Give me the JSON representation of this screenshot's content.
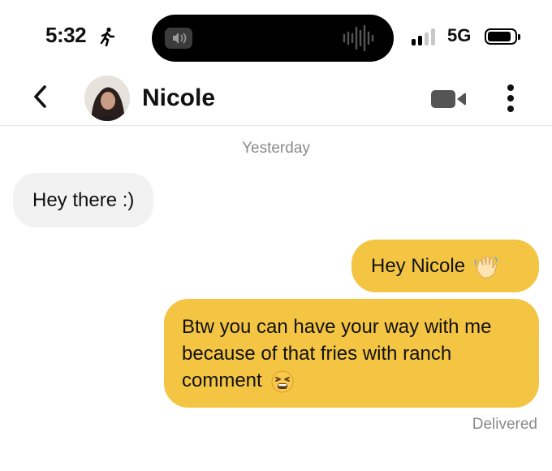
{
  "status_bar": {
    "time": "5:32",
    "network": "5G",
    "activity_icon": "walking-person-icon",
    "signal_bars_active": 2,
    "signal_bars_total": 4
  },
  "header": {
    "back_icon": "chevron-left-icon",
    "contact_name": "Nicole",
    "video_icon": "video-camera-icon",
    "more_icon": "vertical-ellipsis-icon"
  },
  "chat": {
    "day_label": "Yesterday",
    "messages": [
      {
        "direction": "incoming",
        "text": "Hey there :)"
      },
      {
        "direction": "outgoing",
        "text": "Hey Nicole",
        "emoji": "waving-hand-emoji"
      },
      {
        "direction": "outgoing",
        "text": "Btw you can have your way with me because of that fries with ranch comment",
        "emoji": "tired-face-emoji"
      }
    ],
    "delivery_status": "Delivered"
  },
  "colors": {
    "outgoing_bubble": "#f4c542",
    "incoming_bubble": "#f2f2f2",
    "meta_text": "#8a8a8a"
  }
}
